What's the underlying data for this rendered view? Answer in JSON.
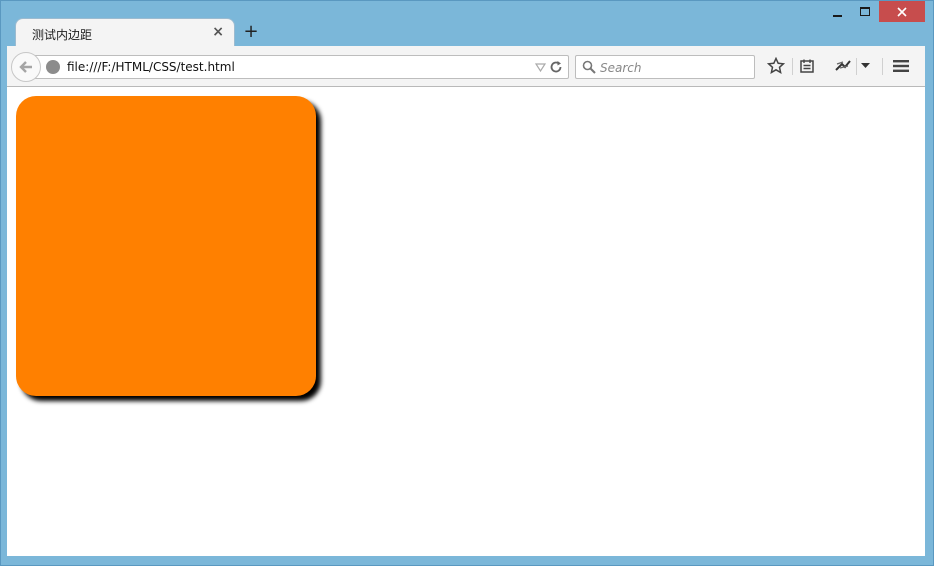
{
  "tab": {
    "title": "测试内边距",
    "close_glyph": "×"
  },
  "new_tab_glyph": "+",
  "toolbar": {
    "url": "file:///F:/HTML/CSS/test.html",
    "search_placeholder": "Search"
  },
  "colors": {
    "box": "#ff8000",
    "close_button": "#c74d4d",
    "frame": "#7bb7d9"
  },
  "icons": {
    "back": "back-arrow-icon",
    "site": "globe-icon",
    "reload": "reload-icon",
    "search": "search-icon",
    "bookmark": "star-icon",
    "reading_list": "reading-list-icon",
    "extension": "extension-icon",
    "menu": "hamburger-icon"
  }
}
